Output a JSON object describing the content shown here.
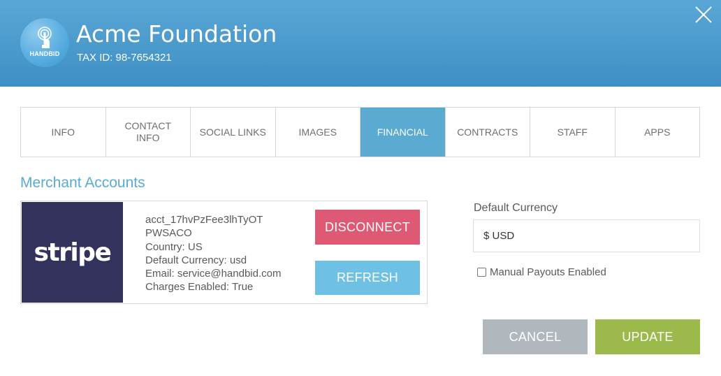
{
  "header": {
    "logo_text": "HANDBID",
    "org_name": "Acme Foundation",
    "tax_id": "TAX ID: 98-7654321",
    "close_icon": "close-icon"
  },
  "tabs": [
    {
      "label": "INFO",
      "active": false
    },
    {
      "label": "CONTACT\nINFO",
      "active": false
    },
    {
      "label": "SOCIAL LINKS",
      "active": false
    },
    {
      "label": "IMAGES",
      "active": false
    },
    {
      "label": "FINANCIAL",
      "active": true
    },
    {
      "label": "CONTRACTS",
      "active": false
    },
    {
      "label": "STAFF",
      "active": false
    },
    {
      "label": "APPS",
      "active": false
    }
  ],
  "merchant": {
    "title": "Merchant Accounts",
    "logo_text": "stripe",
    "details": [
      "acct_17hvPzFee3lhTyOT",
      "PWSACO",
      "Country: US",
      "Default Currency: usd",
      "Email: service@handbid.com",
      "Charges Enabled: True"
    ],
    "disconnect_label": "DISCONNECT",
    "refresh_label": "REFRESH"
  },
  "currency": {
    "label": "Default Currency",
    "value": "$ USD",
    "manual_payouts_label": "Manual Payouts Enabled",
    "manual_payouts_checked": false
  },
  "actions": {
    "cancel_label": "CANCEL",
    "update_label": "UPDATE"
  },
  "colors": {
    "header": "#4a9acd",
    "active_tab": "#5aaad2",
    "disconnect": "#de5a74",
    "refresh": "#6ec1e4",
    "cancel": "#b0b7bd",
    "update": "#9cba4c",
    "stripe_bg": "#32325d"
  }
}
